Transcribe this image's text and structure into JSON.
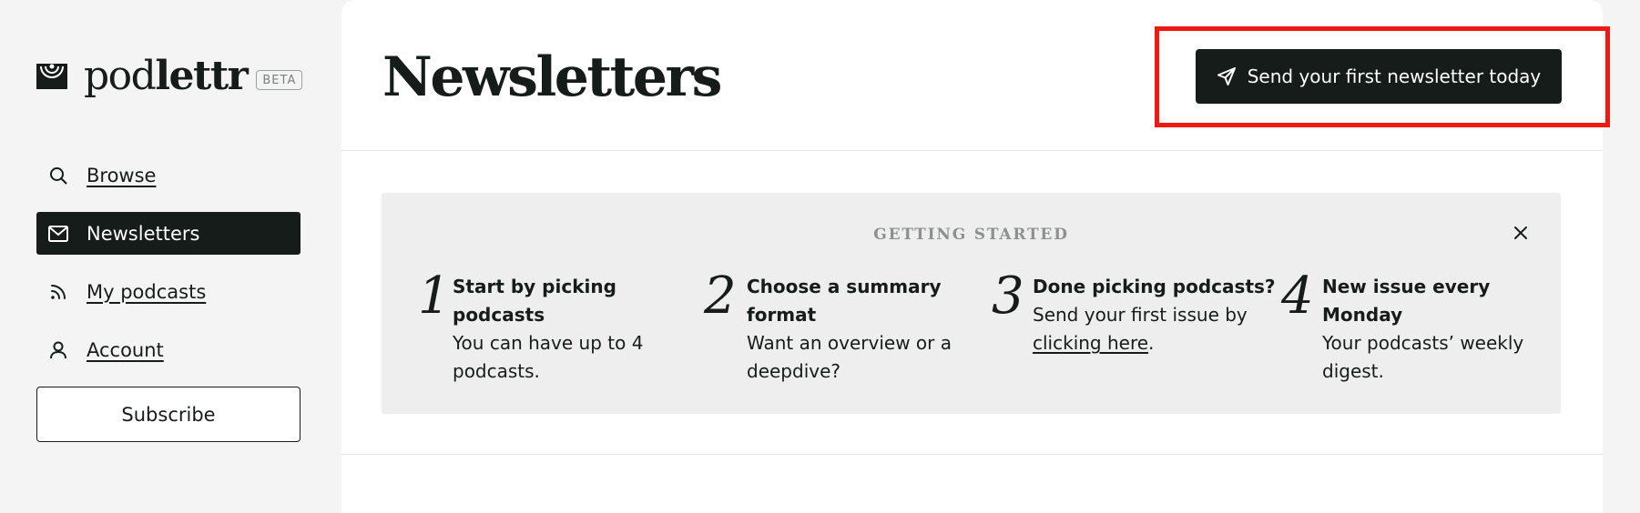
{
  "brand": {
    "name_light": "pod",
    "name_bold": "lettr",
    "badge": "BETA"
  },
  "nav": {
    "items": [
      {
        "label": "Browse",
        "icon": "search-icon",
        "active": false
      },
      {
        "label": "Newsletters",
        "icon": "mail-icon",
        "active": true
      },
      {
        "label": "My podcasts",
        "icon": "rss-icon",
        "active": false
      },
      {
        "label": "Account",
        "icon": "user-icon",
        "active": false
      }
    ],
    "subscribe_label": "Subscribe"
  },
  "header": {
    "title": "Newsletters",
    "cta_label": "Send your first newsletter today",
    "cta_icon": "send-icon",
    "highlight_color": "#ee1a12"
  },
  "getting_started": {
    "title": "GETTING STARTED",
    "steps": [
      {
        "num": "1",
        "title": "Start by picking podcasts",
        "desc": "You can have up to 4 podcasts."
      },
      {
        "num": "2",
        "title": "Choose a summary format",
        "desc": "Want an overview or a deepdive?"
      },
      {
        "num": "3",
        "title": "Done picking podcasts?",
        "desc_before": "Send your first issue by ",
        "desc_link": "clicking here",
        "desc_after": "."
      },
      {
        "num": "4",
        "title": "New issue every Monday",
        "desc": "Your podcasts’ weekly digest."
      }
    ]
  },
  "colors": {
    "dark": "#151c19",
    "sidebar_bg": "#f4f4f4",
    "card_bg": "#eeeeee"
  }
}
